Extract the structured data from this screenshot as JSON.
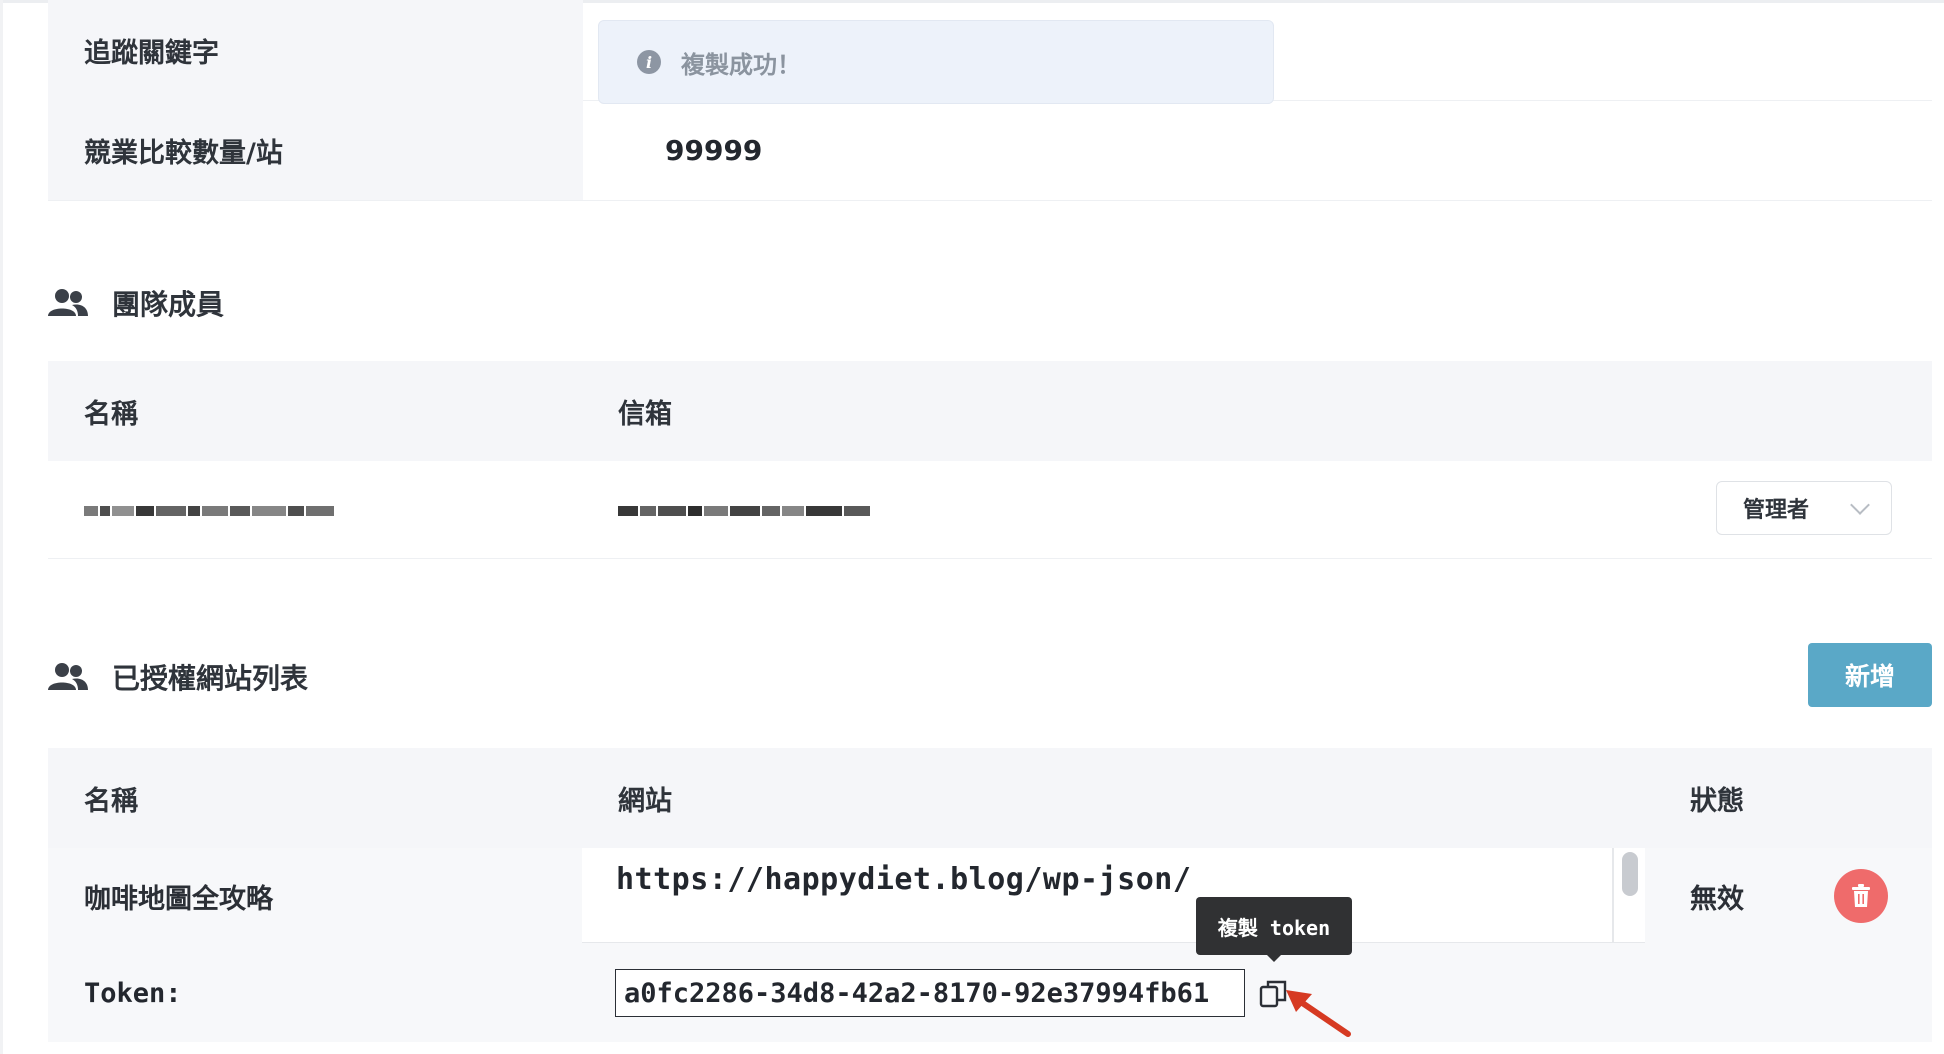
{
  "info": {
    "rows": [
      {
        "label": "追蹤關鍵字",
        "value": ""
      },
      {
        "label": "競業比較數量/站",
        "value": "99999"
      }
    ]
  },
  "toast": {
    "icon": "info-icon",
    "text": "複製成功！"
  },
  "team": {
    "title": "團隊成員",
    "icon": "people-icon",
    "columns": [
      "名稱",
      "信箱"
    ],
    "members": [
      {
        "name": "[blurred]",
        "email": "[blurred]",
        "role": "管理者"
      }
    ]
  },
  "sites": {
    "title": "已授權網站列表",
    "icon": "people-icon",
    "add_label": "新增",
    "columns": [
      "名稱",
      "網站",
      "狀態"
    ],
    "rows": [
      {
        "name": "咖啡地圖全攻略",
        "url": "https://happydiet.blog/wp-json/",
        "status": "無效",
        "token_label": "Token:",
        "token": "a0fc2286-34d8-42a2-8170-92e37994fb61"
      }
    ],
    "copy_tooltip": "複製 token"
  },
  "colors": {
    "accent": "#5aa8c7",
    "danger": "#ef6b6b",
    "header_bg": "#f5f6f9",
    "annotation_arrow": "#d63a22"
  }
}
